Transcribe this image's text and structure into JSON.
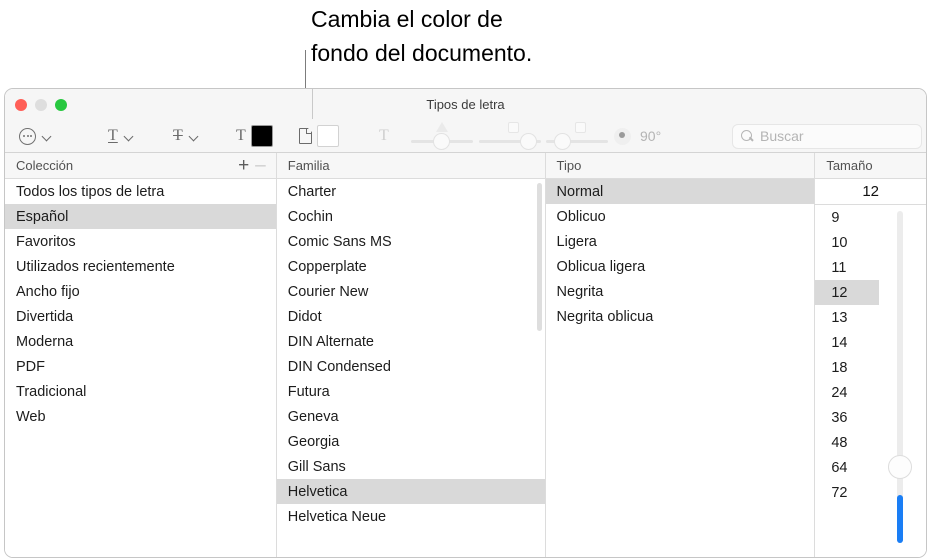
{
  "callout": {
    "text": "Cambia el color de\nfondo del documento."
  },
  "window": {
    "title": "Tipos de letra",
    "traffic_lights": [
      {
        "name": "close",
        "color": "#ff5f57"
      },
      {
        "name": "minimize",
        "color": "#dedede"
      },
      {
        "name": "zoom",
        "color": "#28c840"
      }
    ]
  },
  "toolbar": {
    "actions_menu_icon": "ellipsis-circle-icon",
    "underline_glyph": "T",
    "strikethrough_glyph": "T",
    "text_color_glyph": "T",
    "text_color_value": "#000000",
    "document_color_icon": "document-icon",
    "document_color_value": "#ffffff",
    "shadow_toggle_glyph": "T",
    "shadow_opacity_label": "shadow-opacity-slider",
    "shadow_blur_label": "shadow-blur-slider",
    "shadow_offset_label": "shadow-offset-slider",
    "rotation_value": "90°",
    "search_placeholder": "Buscar",
    "search_value": ""
  },
  "columns": {
    "coleccion": {
      "header": "Colección",
      "add_label": "+",
      "remove_label": "–",
      "items": [
        "Todos los tipos de letra",
        "Español",
        "Favoritos",
        "Utilizados recientemente",
        "Ancho fijo",
        "Divertida",
        "Moderna",
        "PDF",
        "Tradicional",
        "Web"
      ],
      "selected_index": 1
    },
    "familia": {
      "header": "Familia",
      "items": [
        "Charter",
        "Cochin",
        "Comic Sans MS",
        "Copperplate",
        "Courier New",
        "Didot",
        "DIN Alternate",
        "DIN Condensed",
        "Futura",
        "Geneva",
        "Georgia",
        "Gill Sans",
        "Helvetica",
        "Helvetica Neue"
      ],
      "selected_index": 12
    },
    "tipo": {
      "header": "Tipo",
      "items": [
        "Normal",
        "Oblicuo",
        "Ligera",
        "Oblicua ligera",
        "Negrita",
        "Negrita oblicua"
      ],
      "selected_index": 0
    },
    "tamano": {
      "header": "Tamaño",
      "field_value": "12",
      "items": [
        "9",
        "10",
        "11",
        "12",
        "13",
        "14",
        "18",
        "24",
        "36",
        "48",
        "64",
        "72"
      ],
      "selected_index": 3,
      "slider_accent": "#1a7ef5"
    }
  }
}
